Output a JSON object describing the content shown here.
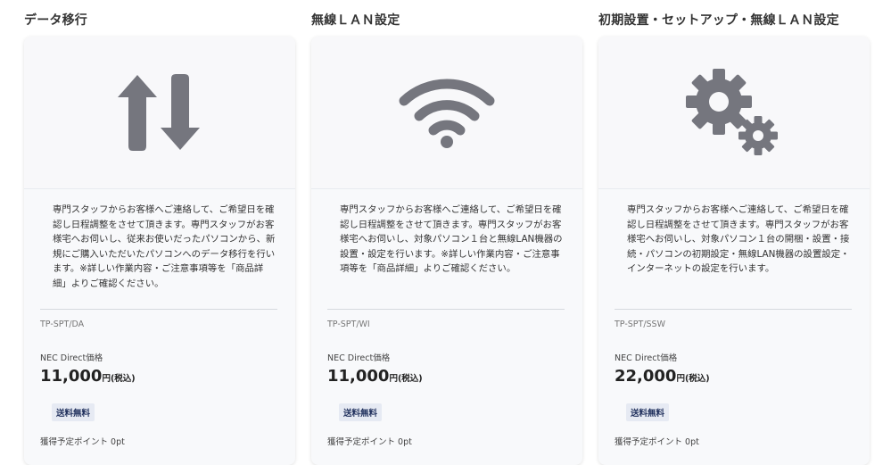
{
  "colors": {
    "icon": "#75767e",
    "badge_bg": "#e6eaf3",
    "badge_text": "#1f2f5c"
  },
  "products": [
    {
      "title": "データ移行",
      "icon": "up-down-arrows-icon",
      "description": "専門スタッフからお客様へご連絡して、ご希望日を確認し日程調整をさせて頂きます。専門スタッフがお客様宅へお伺いし、従来お使いだったパソコンから、新規にご購入いただいたパソコンへのデータ移行を行います。※詳しい作業内容・ご注意事項等を「商品詳細」よりご確認ください。",
      "code": "TP-SPT/DA",
      "price_label": "NEC Direct価格",
      "price": "11,000",
      "price_unit": "円(税込)",
      "badge": "送料無料",
      "points": "獲得予定ポイント 0pt"
    },
    {
      "title": "無線ＬＡＮ設定",
      "icon": "wifi-icon",
      "description": "専門スタッフからお客様へご連絡して、ご希望日を確認し日程調整をさせて頂きます。専門スタッフがお客様宅へお伺いし、対象パソコン１台と無線LAN機器の設置・設定を行います。※詳しい作業内容・ご注意事項等を「商品詳細」よりご確認ください。",
      "code": "TP-SPT/WI",
      "price_label": "NEC Direct価格",
      "price": "11,000",
      "price_unit": "円(税込)",
      "badge": "送料無料",
      "points": "獲得予定ポイント 0pt"
    },
    {
      "title": "初期設置・セットアップ・無線ＬＡＮ設定",
      "icon": "gears-icon",
      "description": "専門スタッフからお客様へご連絡して、ご希望日を確認し日程調整をさせて頂きます。専門スタッフがお客様宅へお伺いし、対象パソコン１台の開梱・設置・接続・パソコンの初期設定・無線LAN機器の設置設定・インターネットの設定を行います。",
      "code": "TP-SPT/SSW",
      "price_label": "NEC Direct価格",
      "price": "22,000",
      "price_unit": "円(税込)",
      "badge": "送料無料",
      "points": "獲得予定ポイント 0pt"
    }
  ]
}
